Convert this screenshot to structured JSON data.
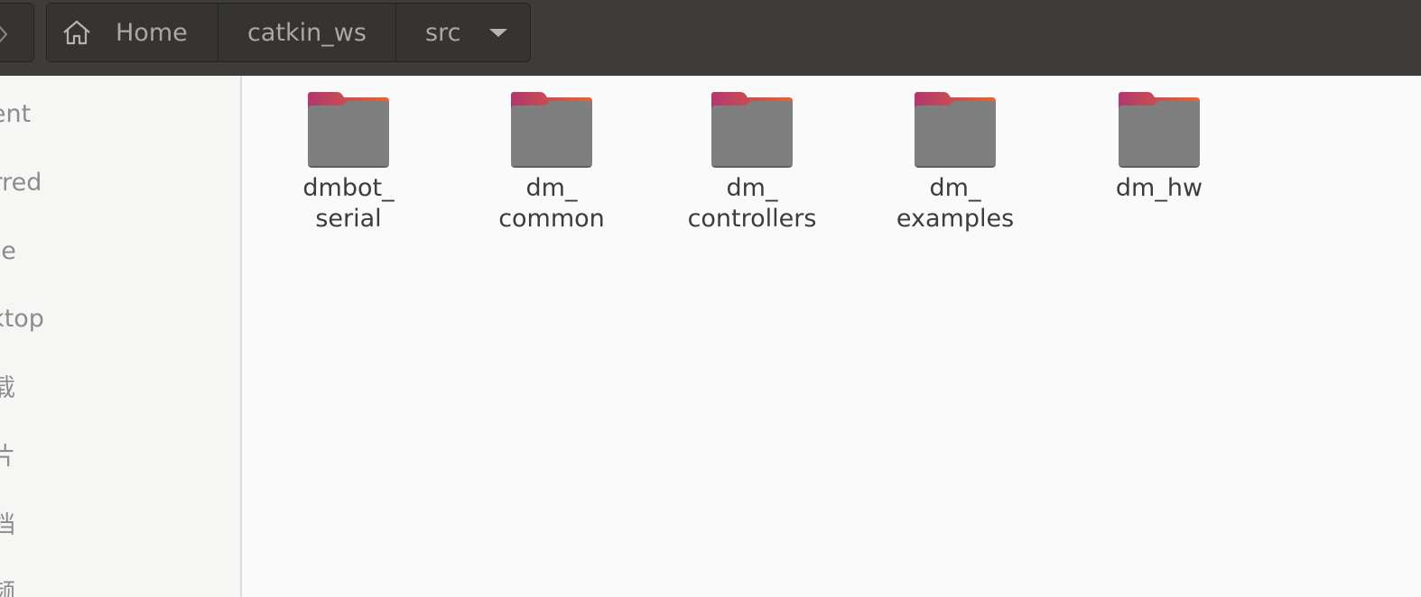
{
  "header": {
    "breadcrumb": [
      {
        "label": "Home",
        "icon": "home-icon"
      },
      {
        "label": "catkin_ws"
      },
      {
        "label": "src",
        "icon": "chevron-down-icon"
      }
    ]
  },
  "sidebar": {
    "items": [
      {
        "label": "cent"
      },
      {
        "label": "arred"
      },
      {
        "label": "me"
      },
      {
        "label": "sktop"
      },
      {
        "label": "载"
      },
      {
        "label": "片"
      },
      {
        "label": "档"
      },
      {
        "label": "频"
      }
    ]
  },
  "files": [
    {
      "name": "dmbot_\nserial",
      "icon": "folder-icon"
    },
    {
      "name": "dm_\ncommon",
      "icon": "folder-icon"
    },
    {
      "name": "dm_\ncontrollers",
      "icon": "folder-icon"
    },
    {
      "name": "dm_\nexamples",
      "icon": "folder-icon"
    },
    {
      "name": "dm_hw",
      "icon": "folder-icon"
    }
  ],
  "colors": {
    "header_bg": "#3d3c3a",
    "folder_tab_start": "#b0386f",
    "folder_tab_end": "#e9652f",
    "folder_body": "#7f7f7f"
  }
}
